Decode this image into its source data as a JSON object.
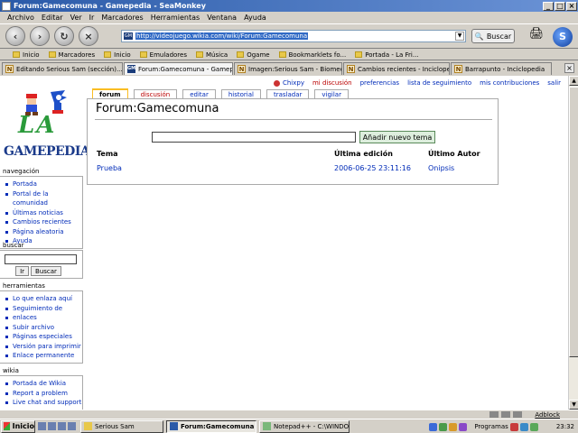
{
  "window": {
    "title": "Forum:Gamecomuna - Gamepedia - SeaMonkey"
  },
  "menu": [
    "Archivo",
    "Editar",
    "Ver",
    "Ir",
    "Marcadores",
    "Herramientas",
    "Ventana",
    "Ayuda"
  ],
  "nav": {
    "url": "http://videojuego.wikia.com/wiki/Forum:Gamecomuna",
    "favicon": "GM",
    "search_label": "Buscar"
  },
  "bookmarks": [
    "Inicio",
    "Marcadores",
    "Inicio",
    "Emuladores",
    "Música",
    "Ogame",
    "Bookmarklets fo...",
    "Portada - La Fri..."
  ],
  "tabs": [
    {
      "icon": "N",
      "label": "Editando Serious Sam (sección)..."
    },
    {
      "icon": "GM",
      "label": "Forum:Gamecomuna - Gamepedia"
    },
    {
      "icon": "N",
      "label": "Imagen:Serious Sam - Biomecan..."
    },
    {
      "icon": "N",
      "label": "Cambios recientes - Inciclopedia"
    },
    {
      "icon": "N",
      "label": "Barrapunto - Inciclopedia"
    }
  ],
  "personal": {
    "user": "Chixpy",
    "links": [
      "mi discusión",
      "preferencias",
      "lista de seguimiento",
      "mis contribuciones",
      "salir"
    ]
  },
  "logo": {
    "la": "LA",
    "name": "GAMEPEDIA"
  },
  "page_tabs": [
    "forum",
    "discusión",
    "editar",
    "historial",
    "trasladar",
    "vigilar"
  ],
  "forum": {
    "title": "Forum:Gamecomuna",
    "add_button": "Añadir nuevo tema",
    "headers": {
      "topic": "Tema",
      "last_edit": "Última edición",
      "last_author": "Último Autor"
    },
    "rows": [
      {
        "topic": "Prueba",
        "last_edit": "2006-06-25 23:11:16",
        "last_author": "Onipsis"
      }
    ]
  },
  "sidebar": {
    "navigation": {
      "title": "navegación",
      "items": [
        "Portada",
        "Portal de la comunidad",
        "Últimas noticias",
        "Cambios recientes",
        "Página aleatoria",
        "Ayuda"
      ]
    },
    "search": {
      "title": "buscar",
      "go": "Ir",
      "search": "Buscar"
    },
    "tools": {
      "title": "herramientas",
      "items": [
        "Lo que enlaza aquí",
        "Seguimiento de",
        "enlaces",
        "Subir archivo",
        "Páginas especiales",
        "Versión para imprimir",
        "Enlace permanente"
      ]
    },
    "wikia": {
      "title": "wikia",
      "items": [
        "Portada de Wikia",
        "Report a problem",
        "Live chat and support"
      ]
    }
  },
  "status": {
    "adblock": "Adblock"
  },
  "taskbar": {
    "start": "Inicio",
    "buttons": [
      "Serious Sam",
      "Forum:Gamecomuna -...",
      "Notepad++ - C:\\WINDOW..."
    ],
    "programs": "Programas",
    "clock": "23:32"
  }
}
